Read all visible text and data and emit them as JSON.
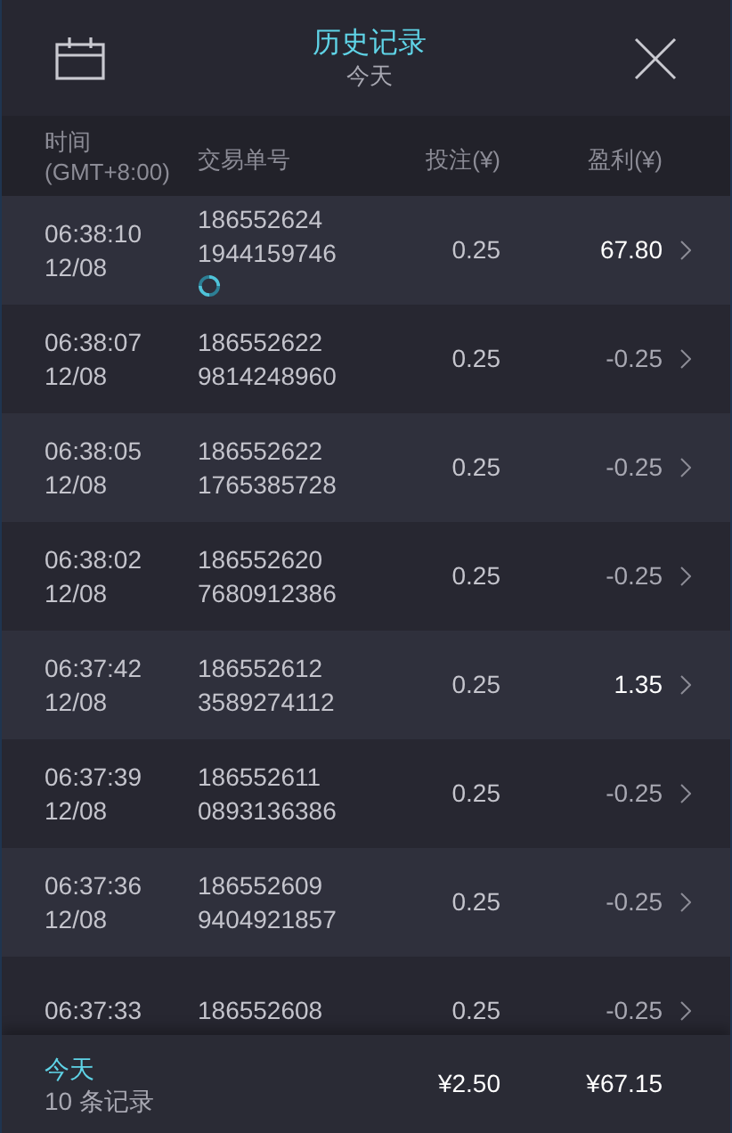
{
  "header": {
    "title": "历史记录",
    "subtitle": "今天"
  },
  "columns": [
    "时间\n(GMT+8:00)",
    "交易单号",
    "投注(¥)",
    "盈利(¥)"
  ],
  "rows": [
    {
      "time": "06:38:10",
      "date": "12/08",
      "order_1": "186552624",
      "order_2": "1944159746",
      "pending": true,
      "stake": "0.25",
      "profit": "67.80",
      "win": true
    },
    {
      "time": "06:38:07",
      "date": "12/08",
      "order_1": "186552622",
      "order_2": "9814248960",
      "pending": false,
      "stake": "0.25",
      "profit": "-0.25",
      "win": false
    },
    {
      "time": "06:38:05",
      "date": "12/08",
      "order_1": "186552622",
      "order_2": "1765385728",
      "pending": false,
      "stake": "0.25",
      "profit": "-0.25",
      "win": false
    },
    {
      "time": "06:38:02",
      "date": "12/08",
      "order_1": "186552620",
      "order_2": "7680912386",
      "pending": false,
      "stake": "0.25",
      "profit": "-0.25",
      "win": false
    },
    {
      "time": "06:37:42",
      "date": "12/08",
      "order_1": "186552612",
      "order_2": "3589274112",
      "pending": false,
      "stake": "0.25",
      "profit": "1.35",
      "win": true
    },
    {
      "time": "06:37:39",
      "date": "12/08",
      "order_1": "186552611",
      "order_2": "0893136386",
      "pending": false,
      "stake": "0.25",
      "profit": "-0.25",
      "win": false
    },
    {
      "time": "06:37:36",
      "date": "12/08",
      "order_1": "186552609",
      "order_2": "9404921857",
      "pending": false,
      "stake": "0.25",
      "profit": "-0.25",
      "win": false
    },
    {
      "time": "06:37:33",
      "order_1": "186552608",
      "stake": "0.25",
      "profit": "-0.25",
      "win": false
    }
  ],
  "footer": {
    "period": "今天",
    "count": "10 条记录",
    "total_stake": "¥2.50",
    "total_profit": "¥67.15"
  }
}
